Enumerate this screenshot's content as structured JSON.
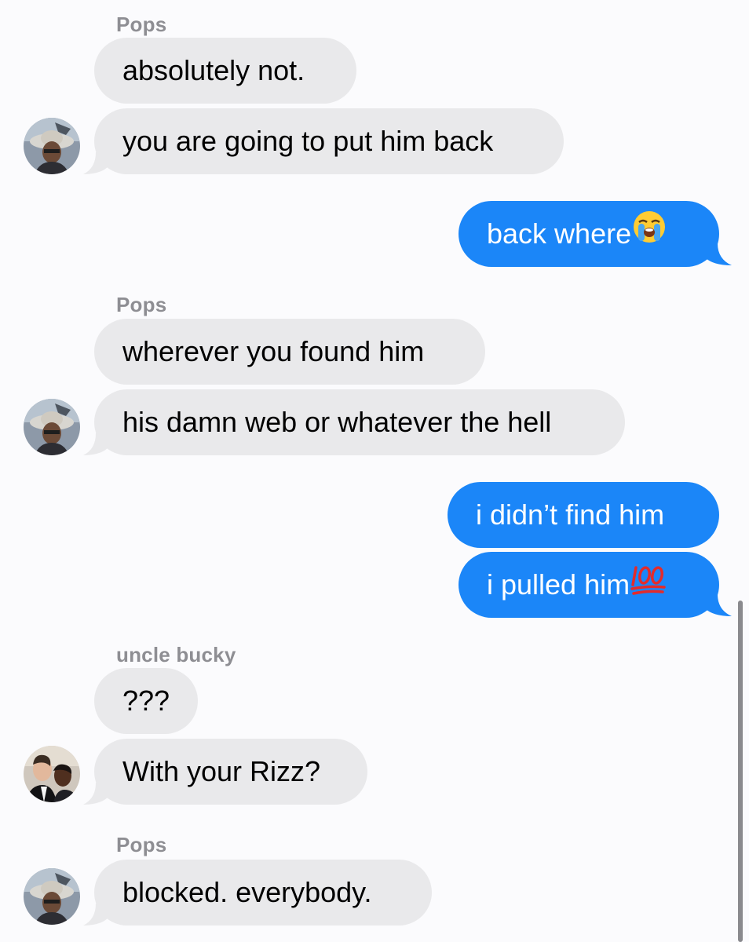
{
  "conversation": {
    "groups": [
      {
        "sender": "Pops",
        "messages": [
          "absolutely not.",
          "you are going to put him back"
        ]
      },
      {
        "outgoing": [
          "back where"
        ]
      },
      {
        "sender": "Pops",
        "messages": [
          "wherever you found him",
          "his damn web or whatever the hell"
        ]
      },
      {
        "outgoing": [
          "i didn’t find him",
          "i pulled him"
        ]
      },
      {
        "sender": "uncle bucky",
        "messages": [
          "???",
          "With your Rizz?"
        ]
      },
      {
        "sender": "Pops",
        "messages": [
          "blocked. everybody."
        ]
      }
    ]
  },
  "emoji": {
    "crying_face": "loudly-crying-face-icon",
    "hundred": "hundred-points-icon"
  },
  "colors": {
    "background": "#fbfbfd",
    "incoming_bubble": "#e9e9eb",
    "outgoing_bubble": "#1b86f8",
    "sender_name": "#8e8e93"
  }
}
